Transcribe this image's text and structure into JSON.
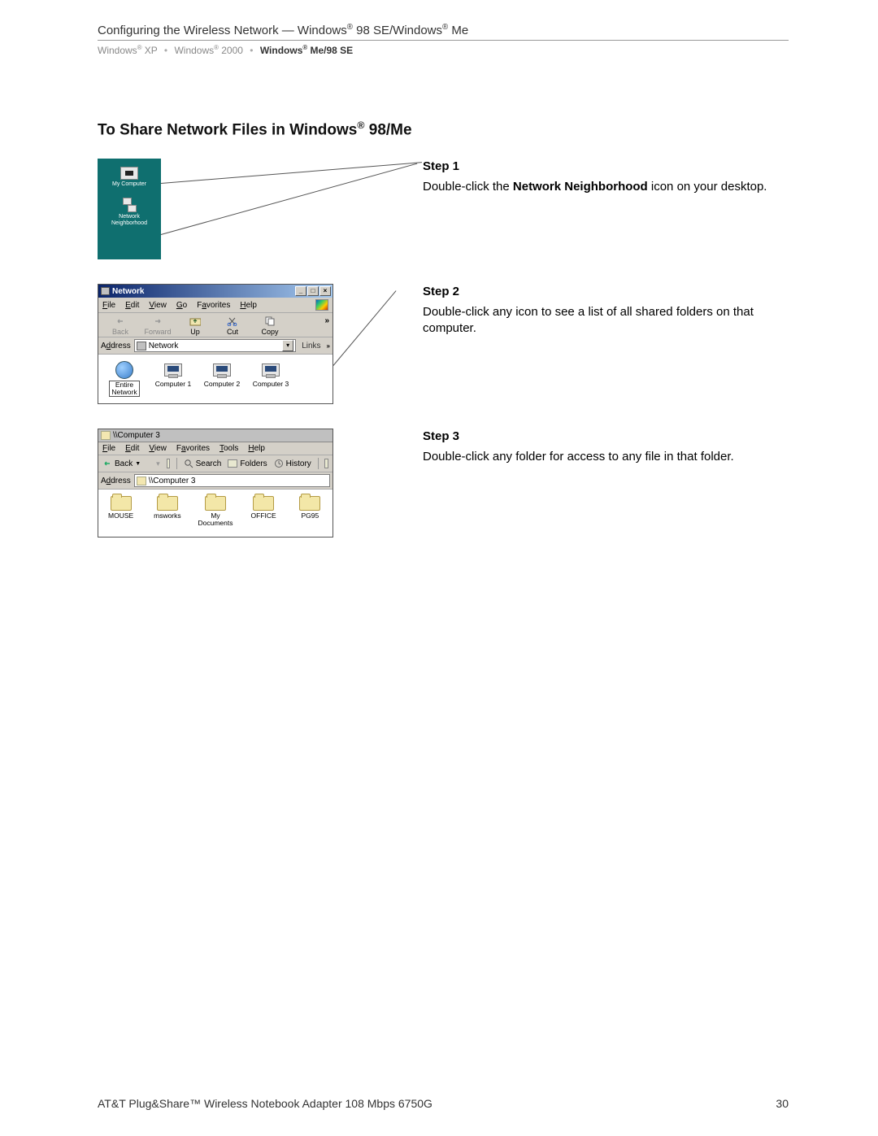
{
  "header": {
    "title_prefix": "Configuring the Wireless Network — Windows",
    "title_mid": " 98 SE/Windows",
    "title_suffix": " Me",
    "reg": "®"
  },
  "breadcrumb": {
    "item1_a": "Windows",
    "item1_b": " XP",
    "item2_a": "Windows",
    "item2_b": " 2000",
    "item3_a": "Windows",
    "item3_b": " Me/98 SE",
    "sep": "•",
    "reg": "®"
  },
  "section": {
    "title_a": "To Share Network Files in Windows",
    "title_b": " 98/Me",
    "reg": "®"
  },
  "steps": {
    "s1": {
      "label": "Step 1",
      "pre": "Double-click the ",
      "bold": "Network Neighborhood",
      "post": " icon on your desktop."
    },
    "s2": {
      "label": "Step 2",
      "text": "Double-click any icon to see a list of all shared folders on that computer."
    },
    "s3": {
      "label": "Step 3",
      "text": "Double-click any folder for access to any file in that folder."
    }
  },
  "desktop": {
    "icon1": "My Computer",
    "icon2a": "Network",
    "icon2b": "Neighborhood"
  },
  "win1": {
    "title": "Network",
    "menu": {
      "file": "File",
      "edit": "Edit",
      "view": "View",
      "go": "Go",
      "fav": "Favorites",
      "help": "Help"
    },
    "tb": {
      "back": "Back",
      "forward": "Forward",
      "up": "Up",
      "cut": "Cut",
      "copy": "Copy",
      "chev": "»"
    },
    "addr": {
      "label": "Address",
      "value": "Network",
      "links": "Links",
      "chev": "»"
    },
    "icons": {
      "entire_a": "Entire",
      "entire_b": "Network",
      "c1": "Computer 1",
      "c2": "Computer 2",
      "c3": "Computer 3"
    }
  },
  "win2": {
    "title": "\\\\Computer 3",
    "menu": {
      "file": "File",
      "edit": "Edit",
      "view": "View",
      "fav": "Favorites",
      "tools": "Tools",
      "help": "Help"
    },
    "tb": {
      "back": "Back",
      "search": "Search",
      "folders": "Folders",
      "history": "History"
    },
    "addr": {
      "label": "Address",
      "value": "\\\\Computer 3"
    },
    "folders": {
      "f1": "MOUSE",
      "f2": "msworks",
      "f3a": "My",
      "f3b": "Documents",
      "f4": "OFFICE",
      "f5": "PG95"
    }
  },
  "footer": {
    "left": "AT&T Plug&Share™ Wireless Notebook Adapter 108 Mbps 6750G",
    "page": "30"
  }
}
